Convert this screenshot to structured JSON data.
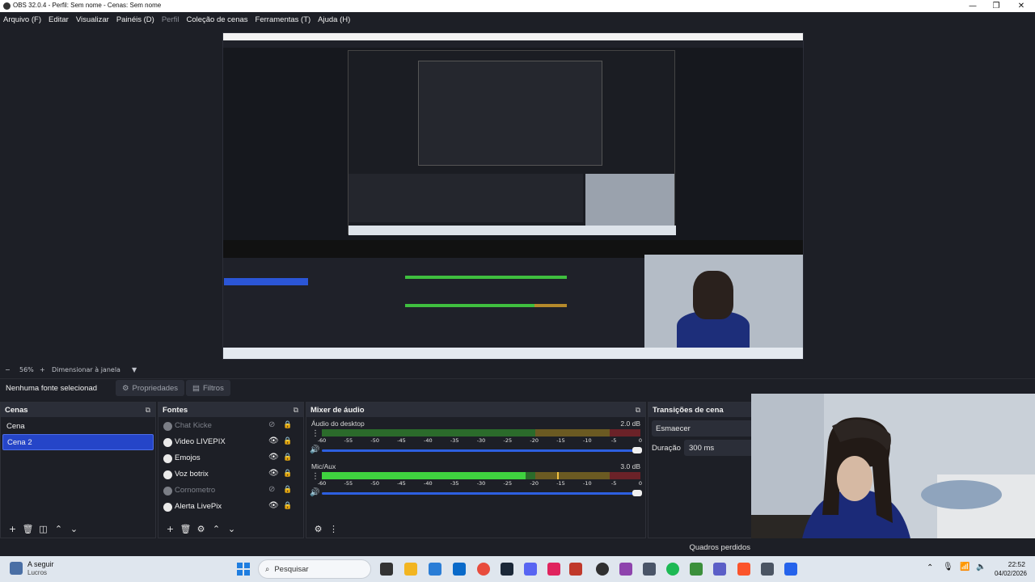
{
  "window": {
    "title": "OBS 32.0.4 - Perfil: Sem nome - Cenas: Sem nome",
    "minimize": "—",
    "maximize": "❐",
    "close": "✕"
  },
  "menu": {
    "items": [
      "Arquivo (F)",
      "Editar",
      "Visualizar",
      "Painéis (D)",
      "Perfil",
      "Coleção de cenas",
      "Ferramentas (T)",
      "Ajuda (H)"
    ]
  },
  "zoom": {
    "minus": "−",
    "value": "56%",
    "plus": "+",
    "fit_label": "Dimensionar à janela",
    "dropdown": "▼"
  },
  "context": {
    "no_source": "Nenhuma fonte selecionad",
    "properties": "Propriedades",
    "filters": "Filtros"
  },
  "scenes": {
    "title": "Cenas",
    "items": [
      "Cena",
      "Cena 2"
    ],
    "selected": "Cena 2"
  },
  "sources": {
    "title": "Fontes",
    "items": [
      {
        "name": "Chat Kicke",
        "visible": false
      },
      {
        "name": "Video LIVEPIX",
        "visible": true
      },
      {
        "name": "Emojos",
        "visible": true
      },
      {
        "name": "Voz botrix",
        "visible": true
      },
      {
        "name": "Cornometro",
        "visible": false
      },
      {
        "name": "Alerta LivePix",
        "visible": true
      }
    ]
  },
  "mixer": {
    "title": "Mixer de áudio",
    "ticks": [
      "-60",
      "-55",
      "-50",
      "-45",
      "-40",
      "-35",
      "-30",
      "-25",
      "-20",
      "-15",
      "-10",
      "-5",
      "0"
    ],
    "channels": [
      {
        "name": "Áudio do desktop",
        "db": "2.0 dB",
        "level_fraction": 0,
        "volume_fraction": 1.0
      },
      {
        "name": "Mic/Aux",
        "db": "3.0 dB",
        "level_fraction": 0.64,
        "volume_fraction": 1.0
      }
    ]
  },
  "transitions": {
    "title": "Transições de cena",
    "selected": "Esmaecer",
    "duration_label": "Duração",
    "duration_value": "300 ms"
  },
  "status": {
    "dropped_frames": "Quadros perdidos"
  },
  "taskbar": {
    "weather_title": "A seguir",
    "weather_sub": "Lucros",
    "search_placeholder": "Pesquisar",
    "time": "22:52",
    "date": "04/02/2026"
  }
}
